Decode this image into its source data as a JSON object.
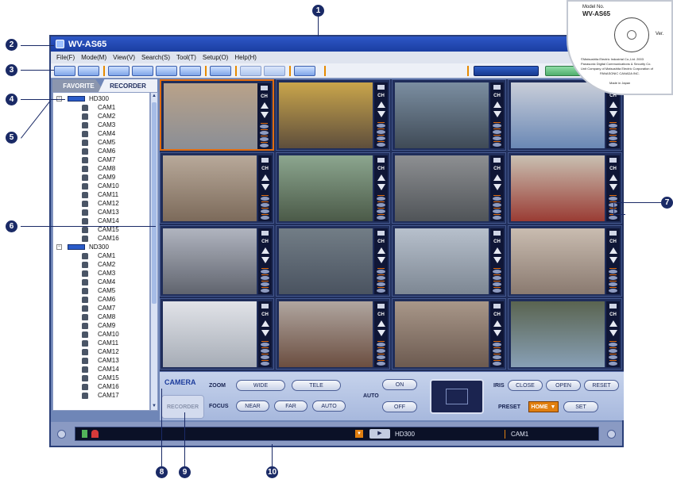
{
  "window": {
    "title": "WV-AS65"
  },
  "menu": [
    "File(F)",
    "Mode(M)",
    "View(V)",
    "Search(S)",
    "Tool(T)",
    "Setup(O)",
    "Help(H)"
  ],
  "tabs": {
    "favorite": "FAVORITE",
    "recorder": "RECORDER"
  },
  "tree": [
    {
      "label": "HD300",
      "type": "recorder"
    },
    {
      "label": "CAM1",
      "type": "camera"
    },
    {
      "label": "CAM2",
      "type": "camera"
    },
    {
      "label": "CAM3",
      "type": "camera"
    },
    {
      "label": "CAM4",
      "type": "camera"
    },
    {
      "label": "CAM5",
      "type": "camera"
    },
    {
      "label": "CAM6",
      "type": "camera"
    },
    {
      "label": "CAM7",
      "type": "camera"
    },
    {
      "label": "CAM8",
      "type": "camera"
    },
    {
      "label": "CAM9",
      "type": "camera"
    },
    {
      "label": "CAM10",
      "type": "camera"
    },
    {
      "label": "CAM11",
      "type": "camera"
    },
    {
      "label": "CAM12",
      "type": "camera"
    },
    {
      "label": "CAM13",
      "type": "camera"
    },
    {
      "label": "CAM14",
      "type": "camera"
    },
    {
      "label": "CAM15",
      "type": "camera"
    },
    {
      "label": "CAM16",
      "type": "camera"
    },
    {
      "label": "ND300",
      "type": "recorder"
    },
    {
      "label": "CAM1",
      "type": "camera"
    },
    {
      "label": "CAM2",
      "type": "camera"
    },
    {
      "label": "CAM3",
      "type": "camera"
    },
    {
      "label": "CAM4",
      "type": "camera"
    },
    {
      "label": "CAM5",
      "type": "camera"
    },
    {
      "label": "CAM6",
      "type": "camera"
    },
    {
      "label": "CAM7",
      "type": "camera"
    },
    {
      "label": "CAM8",
      "type": "camera"
    },
    {
      "label": "CAM9",
      "type": "camera"
    },
    {
      "label": "CAM10",
      "type": "camera"
    },
    {
      "label": "CAM11",
      "type": "camera"
    },
    {
      "label": "CAM12",
      "type": "camera"
    },
    {
      "label": "CAM13",
      "type": "camera"
    },
    {
      "label": "CAM14",
      "type": "camera"
    },
    {
      "label": "CAM15",
      "type": "camera"
    },
    {
      "label": "CAM16",
      "type": "camera"
    },
    {
      "label": "CAM17",
      "type": "camera"
    }
  ],
  "camera_strip": {
    "ch_label": "CH"
  },
  "control": {
    "camera_tab": "CAMERA",
    "recorder_tab": "RECORDER",
    "zoom_label": "ZOOM",
    "zoom_wide": "WIDE",
    "zoom_tele": "TELE",
    "focus_label": "FOCUS",
    "focus_near": "NEAR",
    "focus_far": "FAR",
    "focus_auto": "AUTO",
    "auto_label": "AUTO",
    "auto_on": "ON",
    "auto_off": "OFF",
    "iris_label": "IRIS",
    "iris_close": "CLOSE",
    "iris_open": "OPEN",
    "iris_reset": "RESET",
    "preset_label": "PRESET",
    "preset_home": "HOME",
    "preset_set": "SET"
  },
  "status": {
    "recorder": "HD300",
    "camera": "CAM1"
  },
  "cd": {
    "model_label": "Model No.",
    "model": "WV-AS65",
    "version": "Ver.",
    "company1": "©Matsushita Electric Industrial Co.,Ltd. 2003",
    "company2": "Panasonic Digital Communications & Security Co.",
    "company3": "Unit Company of Matsushita Electric Corporation of",
    "company4": "PANASONIC CANADA INC.",
    "made_in": "Made in Japan"
  },
  "callouts": [
    "1",
    "2",
    "3",
    "4",
    "5",
    "6",
    "7",
    "8",
    "9",
    "10"
  ],
  "colors": {
    "accent": "#e06c10",
    "window": "#6f86b7",
    "callout": "#1a2a66"
  }
}
